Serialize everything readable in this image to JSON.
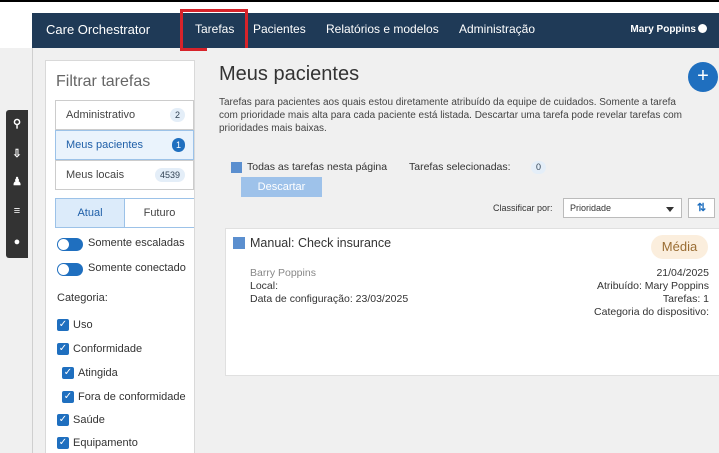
{
  "topbar": {
    "brand": "Care Orchestrator",
    "nav": [
      "Tarefas",
      "Pacientes",
      "Relatórios e modelos",
      "Administração"
    ],
    "user": "Mary Poppins"
  },
  "sidebar_icons": [
    "search-icon",
    "download-icon",
    "add-user-icon",
    "list-icon",
    "chat-icon"
  ],
  "filter": {
    "title": "Filtrar tarefas",
    "groups": [
      {
        "label": "Administrativo",
        "count": "2"
      },
      {
        "label": "Meus pacientes",
        "count": "1"
      },
      {
        "label": "Meus locais",
        "count": "4539"
      }
    ],
    "tabs": [
      "Atual",
      "Futuro"
    ],
    "toggles": [
      "Somente escaladas",
      "Somente conectado"
    ],
    "category_label": "Categoria:",
    "categories": [
      "Uso",
      "Conformidade",
      "Atingida",
      "Fora de conformidade",
      "Saúde",
      "Equipamento"
    ]
  },
  "main": {
    "title": "Meus pacientes",
    "add_label": "+",
    "description": "Tarefas para pacientes aos quais estou diretamente atribuído da equipe de cuidados. Somente a tarefa com prioridade mais alta para cada paciente está listada. Descartar uma tarefa pode revelar tarefas com prioridades mais baixas.",
    "select_all": "Todas as tarefas nesta página",
    "selected_label": "Tarefas selecionadas:",
    "selected_count": "0",
    "discard": "Descartar",
    "sort_label": "Classificar por:",
    "sort_value": "Prioridade"
  },
  "task": {
    "title": "Manual: Check insurance",
    "priority": "Média",
    "patient": "Barry Poppins",
    "location": "Local:",
    "config_date": "Data de configuração: 23/03/2025",
    "date": "21/04/2025",
    "assigned": "Atribuído: Mary Poppins",
    "tasks": "Tarefas: 1",
    "device_category": "Categoria do dispositivo:"
  },
  "colors": {
    "nav_bg": "#1f3a57",
    "accent": "#1f6fbf",
    "highlight": "#d7232a",
    "priority_bg": "#fbeedd"
  }
}
